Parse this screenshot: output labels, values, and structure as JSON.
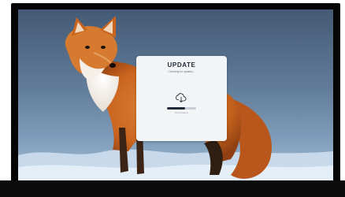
{
  "modal": {
    "title": "UPDATE",
    "subtitle": "Checking for updates...",
    "progress": {
      "fraction": 0.62,
      "label": "Downloading"
    }
  },
  "icons": {
    "update": "cloud-download-icon"
  },
  "colors": {
    "modal_bg": "#f3f4f6",
    "progress_fill": "#1f2937",
    "progress_track": "#c9ced6",
    "frame": "#050505"
  }
}
